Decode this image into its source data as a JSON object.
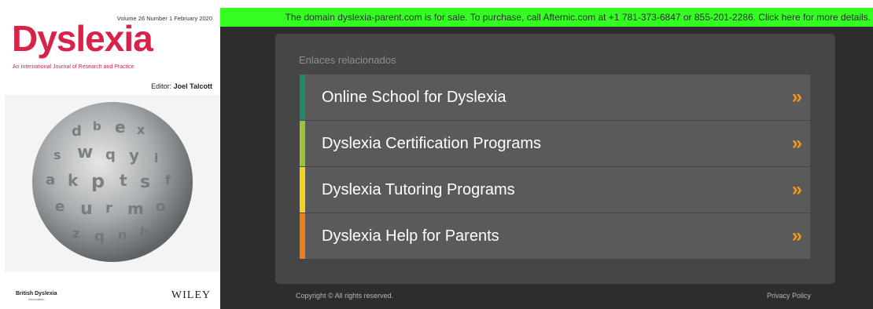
{
  "cover": {
    "volume_line": "Volume 26  Number 1  February 2020",
    "title": "Dyslexia",
    "subtitle": "An International Journal of Research and Practice",
    "editor_label": "Editor:",
    "editor_name": "Joel Talcott",
    "association": "British Dyslexia",
    "association_sub": "Association",
    "publisher": "WILEY",
    "accent_color": "#d8224a"
  },
  "banner": {
    "text": "The domain dyslexia-parent.com is for sale. To purchase, call Afternic.com at +1 781-373-6847 or 855-201-2286. Click here for more details.",
    "color": "#33ff22"
  },
  "related": {
    "heading": "Enlaces relacionados",
    "links": [
      {
        "label": "Online School for Dyslexia",
        "accent": "#1f8a6a",
        "arrow": "»"
      },
      {
        "label": "Dyslexia Certification Programs",
        "accent": "#9cc43a",
        "arrow": "»"
      },
      {
        "label": "Dyslexia Tutoring Programs",
        "accent": "#f2d21e",
        "arrow": "»"
      },
      {
        "label": "Dyslexia Help for Parents",
        "accent": "#f07d1a",
        "arrow": "»"
      }
    ]
  },
  "footer": {
    "copyright": "Copyright © All rights reserved.",
    "privacy": "Privacy Policy"
  }
}
